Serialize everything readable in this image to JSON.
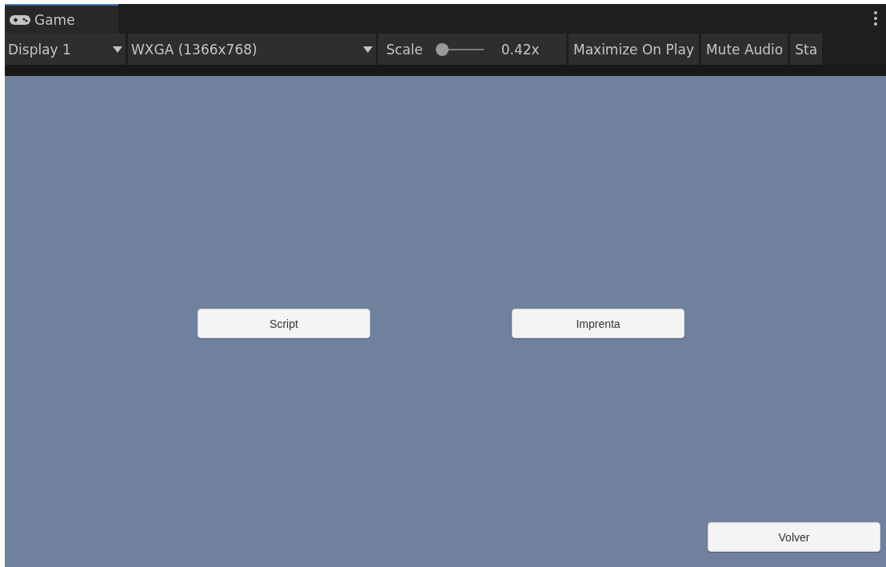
{
  "tabs": [
    {
      "label": "Game",
      "selected": true
    }
  ],
  "toolbar": {
    "display": {
      "value": "Display 1"
    },
    "resolution": {
      "value": "WXGA (1366x768)"
    },
    "scale": {
      "label": "Scale",
      "level": 0,
      "reading": "0.42x"
    },
    "toggles": [
      {
        "label": "Maximize On Play",
        "on": false
      },
      {
        "label": "Mute Audio",
        "on": false
      },
      {
        "label": "Sta",
        "on": false
      }
    ]
  },
  "game_view": {
    "buttons": [
      {
        "label": "Script"
      },
      {
        "label": "Imprenta"
      },
      {
        "label": "Volver"
      }
    ]
  }
}
